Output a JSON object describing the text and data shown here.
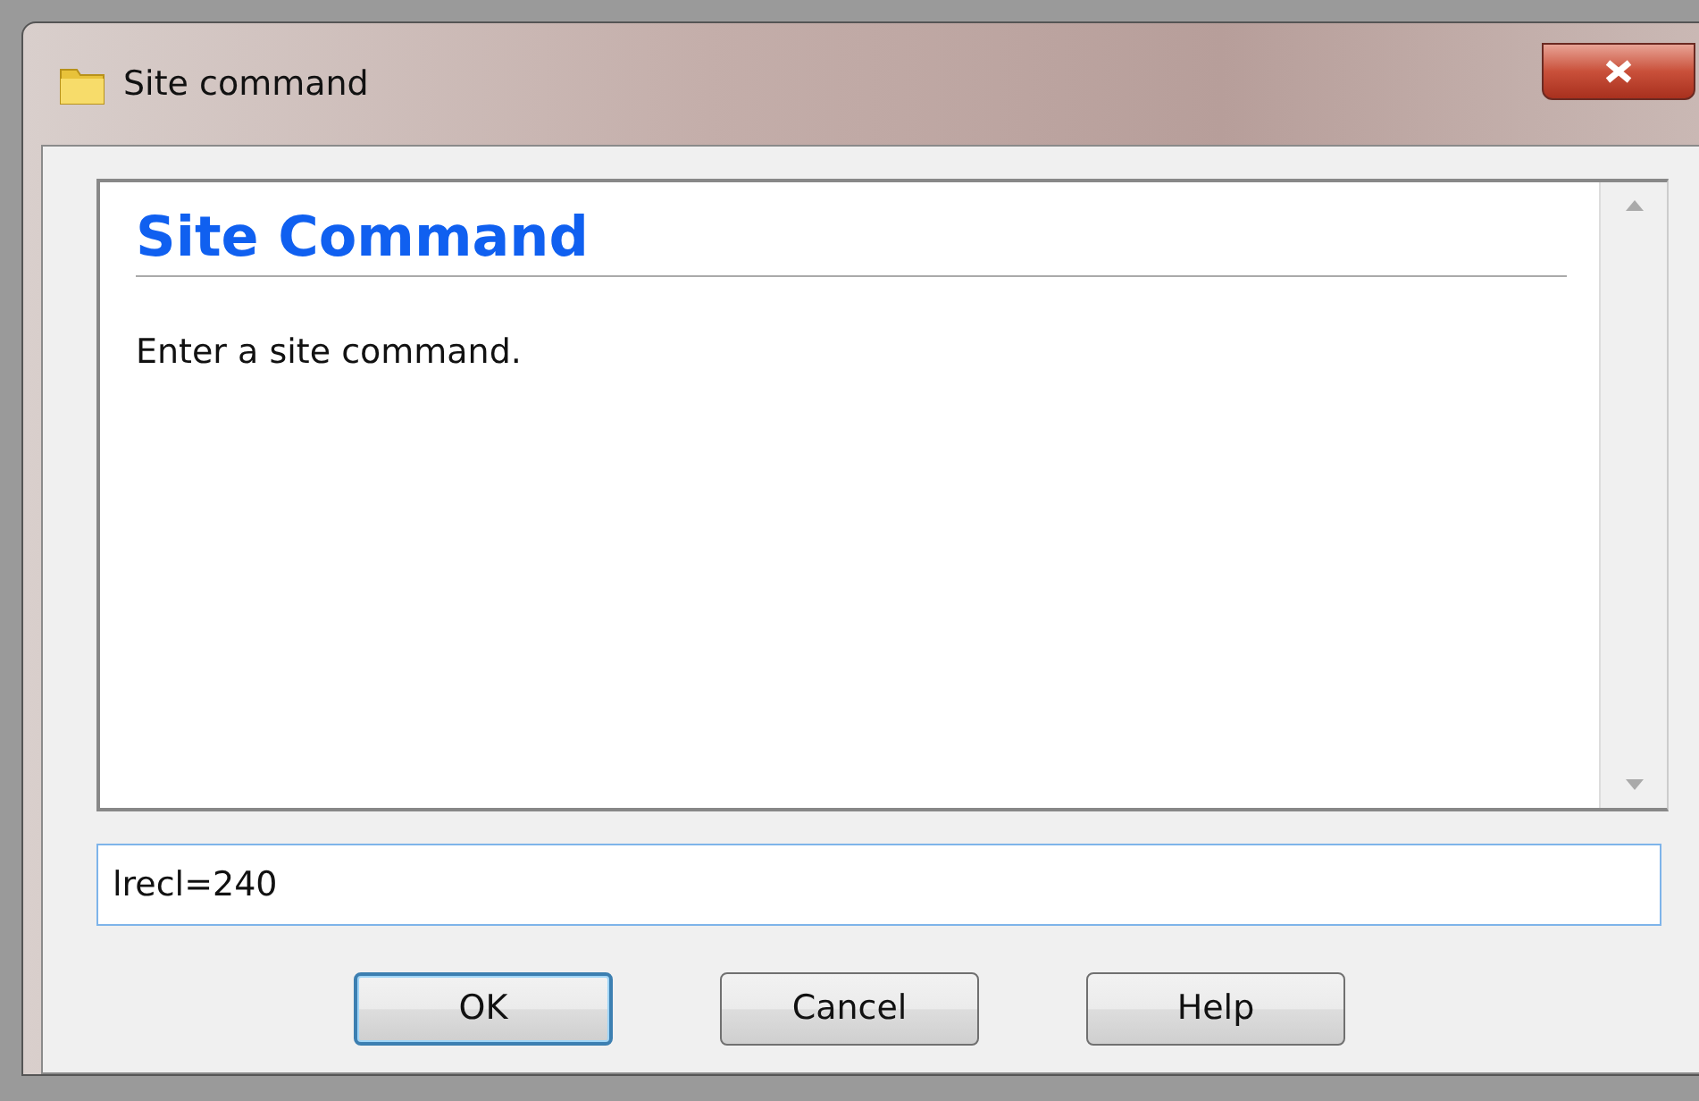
{
  "window": {
    "title": "Site command"
  },
  "help_panel": {
    "heading": "Site Command",
    "text": "Enter a site command."
  },
  "command_field": {
    "value": "lrecl=240",
    "focused": true
  },
  "buttons": [
    {
      "label": "OK",
      "default": true
    },
    {
      "label": "Cancel",
      "default": false
    },
    {
      "label": "Help",
      "default": false
    }
  ]
}
